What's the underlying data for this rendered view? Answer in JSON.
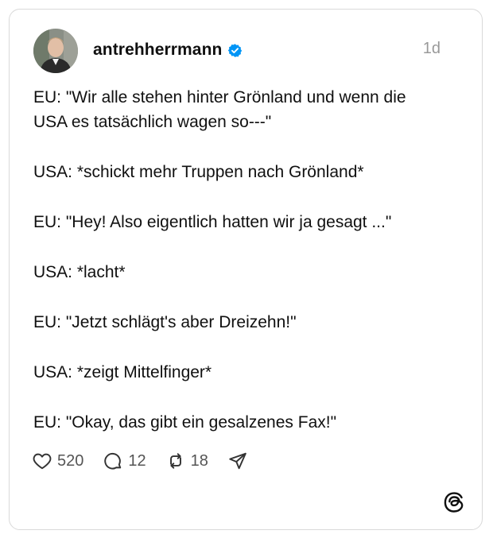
{
  "author": {
    "username": "antrehherrmann",
    "verified": true,
    "avatar_icon": "person-photo"
  },
  "post": {
    "timestamp": "1d",
    "lines": [
      "EU: \"Wir alle stehen hinter Grönland und wenn die",
      "USA es tatsächlich wagen so---\"",
      "USA: *schickt mehr Truppen nach Grönland*",
      "EU: \"Hey! Also eigentlich hatten wir ja gesagt ...\"",
      "USA: *lacht*",
      "EU: \"Jetzt schlägt's aber Dreizehn!\"",
      "USA: *zeigt Mittelfinger*",
      "EU: \"Okay, das gibt ein gesalzenes Fax!\""
    ]
  },
  "actions": {
    "likes": "520",
    "comments": "12",
    "reposts": "18",
    "icons": [
      "heart-icon",
      "comment-icon",
      "repost-icon",
      "share-icon"
    ]
  },
  "branding": {
    "logo": "threads-logo"
  },
  "colors": {
    "text": "#101010",
    "muted": "#999999",
    "count": "#555555",
    "verified": "#0095F6",
    "border": "#d9d9d9"
  }
}
